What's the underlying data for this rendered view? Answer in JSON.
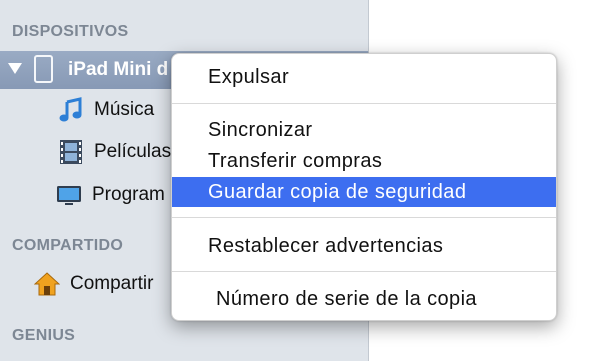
{
  "sidebar": {
    "sections": {
      "dispositivos": "DISPOSITIVOS",
      "compartido": "COMPARTIDO",
      "genius": "GENIUS"
    },
    "device": {
      "label": "iPad Mini d",
      "icon": "ipad-icon"
    },
    "items": [
      {
        "label": "Música",
        "icon": "music-note-icon"
      },
      {
        "label": "Películas",
        "icon": "film-icon"
      },
      {
        "label": "Program",
        "icon": "monitor-icon"
      }
    ],
    "shared": {
      "label": "Compartir",
      "icon": "home-sharing-icon"
    }
  },
  "context_menu": {
    "expulsar": "Expulsar",
    "sincronizar": "Sincronizar",
    "transferir": "Transferir compras",
    "guardar": "Guardar copia de seguridad",
    "restablecer": "Restablecer advertencias",
    "numero_serie": "Número de serie de la copia"
  },
  "colors": {
    "selection": "#3d6ef0",
    "sidebar_bg": "#dfe4ea",
    "section_header": "#7d8794"
  }
}
